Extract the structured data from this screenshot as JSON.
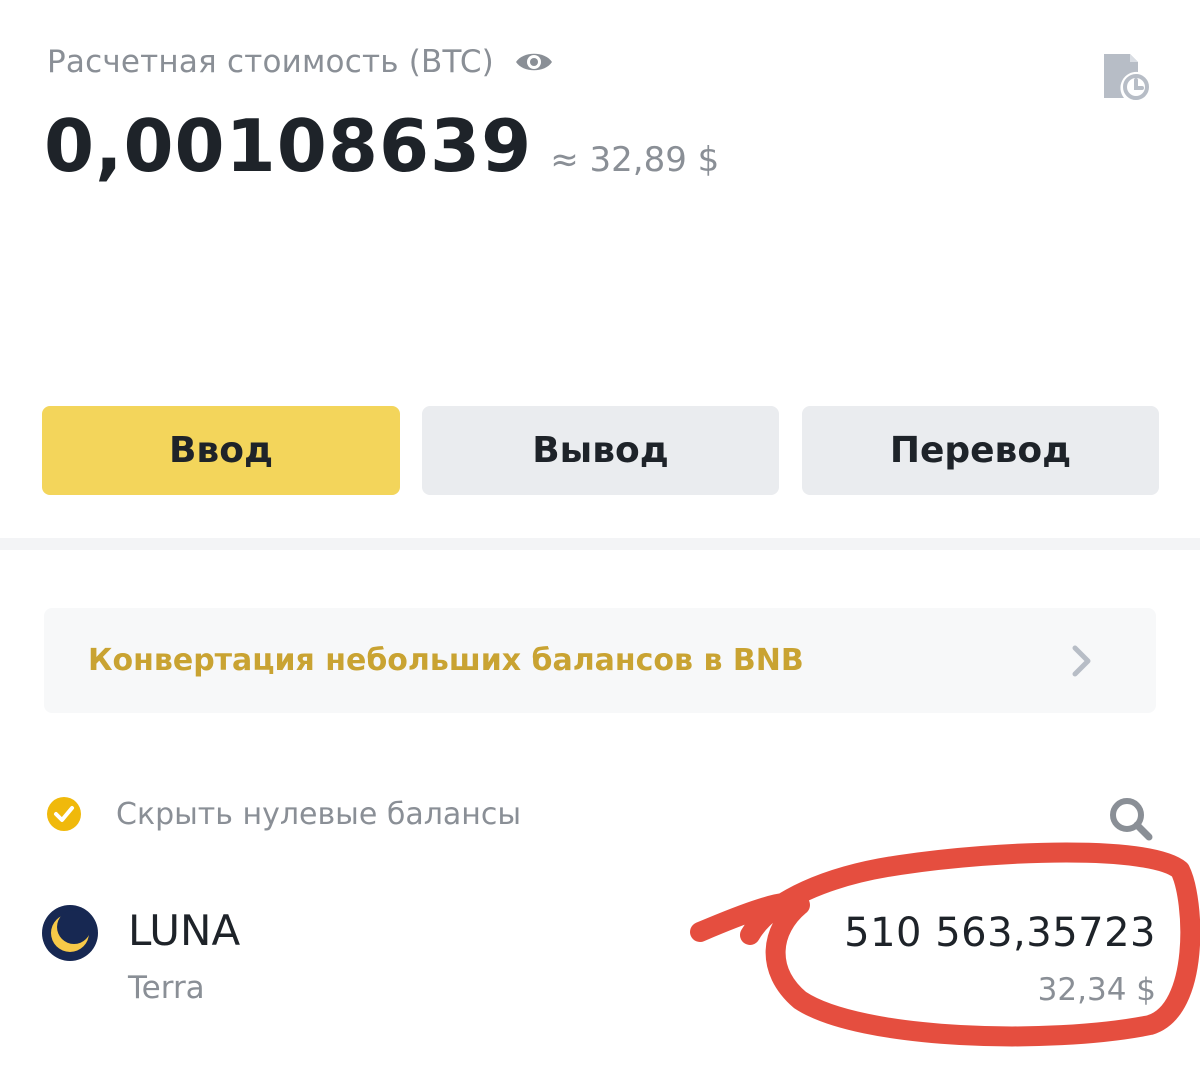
{
  "header": {
    "estimated_label": "Расчетная стоимость (BTC)",
    "btc_value": "0,00108639",
    "usd_approx": "≈ 32,89 $"
  },
  "actions": {
    "deposit_label": "Ввод",
    "withdraw_label": "Вывод",
    "transfer_label": "Перевод"
  },
  "convert_banner": {
    "text": "Конвертация небольших балансов в BNB"
  },
  "filters": {
    "hide_zero_label": "Скрыть нулевые балансы",
    "hide_zero_checked": true
  },
  "assets": [
    {
      "symbol": "LUNA",
      "name": "Terra",
      "amount": "510 563,35723",
      "usd_value": "32,34 $"
    }
  ],
  "colors": {
    "accent_yellow": "#f3d55b",
    "gold_text": "#c9a332",
    "secondary_button": "#eaecef",
    "muted_text": "#8a8f96",
    "annotation_red": "#e23b2a"
  },
  "icons": {
    "eye": "eye-icon",
    "history": "history-icon",
    "chevron": "chevron-right-icon",
    "check": "check-circle-icon",
    "search": "search-icon",
    "luna": "luna-coin-icon"
  }
}
